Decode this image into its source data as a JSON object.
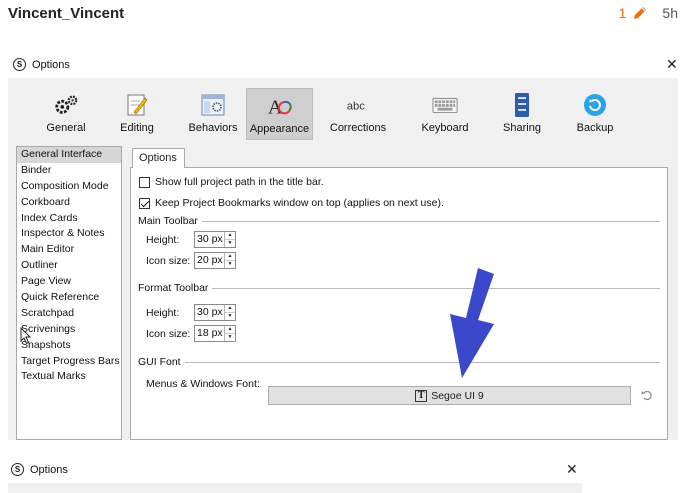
{
  "post": {
    "username": "Vincent_Vincent",
    "edit_count": "1",
    "age": "5h"
  },
  "dialog": {
    "title": "Options",
    "close_glyph": "✕",
    "toolbar": [
      {
        "label": "General",
        "icon": "gears-icon"
      },
      {
        "label": "Editing",
        "icon": "pencil-doc-icon"
      },
      {
        "label": "Behaviors",
        "icon": "window-gear-icon"
      },
      {
        "label": "Appearance",
        "icon": "font-palette-icon",
        "active": true
      },
      {
        "label": "Corrections",
        "icon": "abc-icon"
      },
      {
        "label": "Keyboard",
        "icon": "keyboard-icon"
      },
      {
        "label": "Sharing",
        "icon": "sharing-icon"
      },
      {
        "label": "Backup",
        "icon": "backup-icon"
      }
    ],
    "sidebar": [
      "General Interface",
      "Binder",
      "Composition Mode",
      "Corkboard",
      "Index Cards",
      "Inspector & Notes",
      "Main Editor",
      "Outliner",
      "Page View",
      "Quick Reference",
      "Scratchpad",
      "Scrivenings",
      "Snapshots",
      "Target Progress Bars",
      "Textual Marks"
    ],
    "tab_label": "Options",
    "checks": [
      {
        "label": "Show full project path in the title bar.",
        "checked": false
      },
      {
        "label": "Keep Project Bookmarks window on top (applies on next use).",
        "checked": true
      }
    ],
    "main_toolbar": {
      "heading": "Main Toolbar",
      "height_label": "Height:",
      "height_value": "30 px",
      "icon_label": "Icon size:",
      "icon_value": "20 px"
    },
    "format_toolbar": {
      "heading": "Format Toolbar",
      "height_label": "Height:",
      "height_value": "30 px",
      "icon_label": "Icon size:",
      "icon_value": "18 px"
    },
    "gui_font": {
      "heading": "GUI Font",
      "label": "Menus & Windows Font:",
      "value": "Segoe UI 9"
    },
    "colors": {
      "arrow": "#3a48c9",
      "accent_orange": "#e86d0c",
      "dialog_bg": "#f0f0f0"
    }
  },
  "second_window": {
    "title": "Options",
    "close_glyph": "✕"
  }
}
